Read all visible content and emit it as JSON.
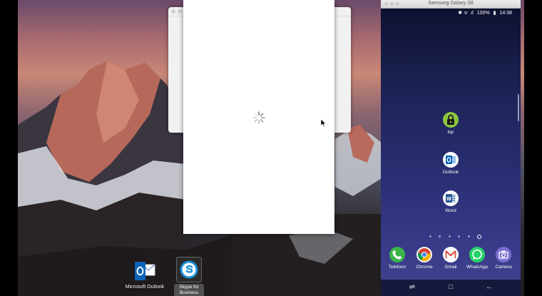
{
  "desktop": {
    "icons": [
      {
        "label": "Microsoft Outlook"
      },
      {
        "label": "Skype for Business"
      }
    ]
  },
  "phone": {
    "window_title": "Samsung Galaxy S8",
    "status": {
      "battery": "100%",
      "time": "14:38",
      "indicators": "✱ ᯤ .ıl"
    },
    "apps": [
      {
        "label": "tiqr",
        "icon": "tiqr-lock-icon"
      },
      {
        "label": "Outlook",
        "icon": "outlook-icon"
      },
      {
        "label": "Word",
        "icon": "word-icon"
      }
    ],
    "dock": [
      {
        "label": "Telefoon",
        "icon": "phone-icon"
      },
      {
        "label": "Chrome",
        "icon": "chrome-icon"
      },
      {
        "label": "Gmail",
        "icon": "gmail-icon"
      },
      {
        "label": "WhatsApp",
        "icon": "whatsapp-icon"
      },
      {
        "label": "Camera",
        "icon": "camera-icon"
      }
    ],
    "nav": {
      "recent": "⇌",
      "home": "□",
      "back": "←"
    },
    "page_count": 5,
    "active_page": "home"
  },
  "colors": {
    "phone_wallpaper": "#2a2f75",
    "tiqr_green": "#8cc63f",
    "outlook_blue": "#0a64b8",
    "word_blue": "#2b5797"
  }
}
